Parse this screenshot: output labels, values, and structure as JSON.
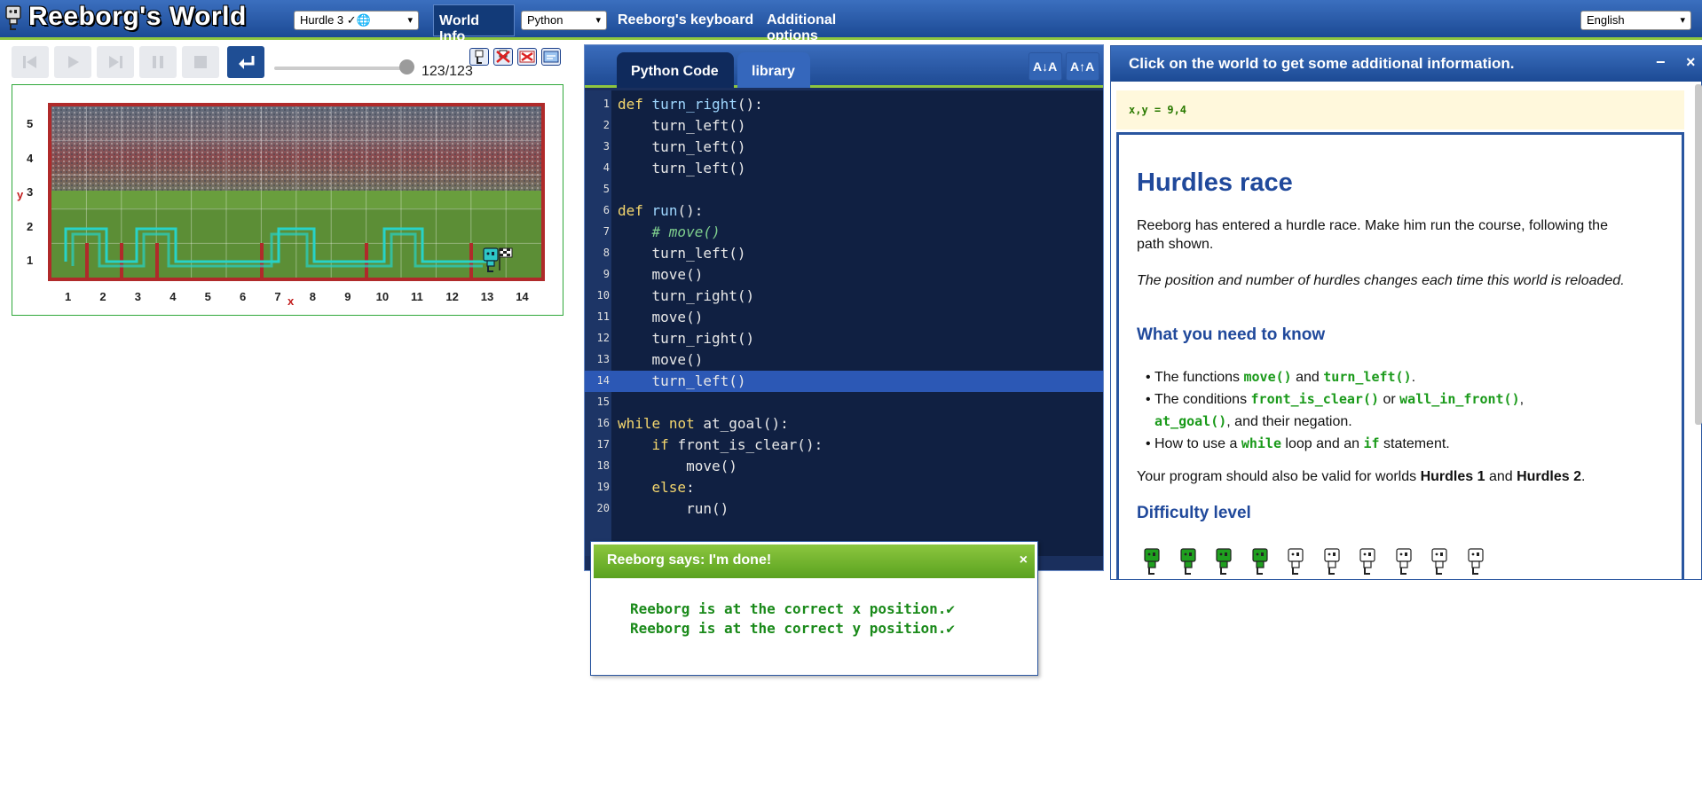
{
  "header": {
    "title": "Reeborg's World",
    "world_select": "Hurdle 3 ✓🌐",
    "world_info_label": "World Info",
    "language_select": "Python",
    "keyboard_label": "Reeborg's keyboard",
    "additional_options_label": "Additional options",
    "ui_language_select": "English"
  },
  "controls": {
    "step_counter": "123/123",
    "progress": 1.0
  },
  "world": {
    "x_axis_letter": "x",
    "y_axis_letter": "y",
    "x_ticks": [
      "1",
      "2",
      "3",
      "4",
      "5",
      "6",
      "7",
      "8",
      "9",
      "10",
      "11",
      "12",
      "13",
      "14"
    ],
    "y_ticks": [
      "5",
      "4",
      "3",
      "2",
      "1"
    ]
  },
  "editor": {
    "tabs": [
      "Python Code",
      "library"
    ],
    "font_smaller": "A↓A",
    "font_larger": "A↑A",
    "active_line": 14,
    "lines": [
      "def turn_right():",
      "    turn_left()",
      "    turn_left()",
      "    turn_left()",
      "",
      "def run():",
      "    # move()",
      "    turn_left()",
      "    move()",
      "    turn_right()",
      "    move()",
      "    turn_right()",
      "    move()",
      "    turn_left()",
      "",
      "while not at_goal():",
      "    if front_is_clear():",
      "        move()",
      "    else:",
      "        run()"
    ]
  },
  "info": {
    "header": "Click on the world to get some additional information.",
    "minimize": "−",
    "close": "×",
    "coords": "x,y = 9,4",
    "title": "Hurdles race",
    "intro": "Reeborg has entered a hurdle race. Make him run the course, following the path shown.",
    "note": "The position and number of hurdles changes each time this world is reloaded.",
    "need_heading": "What you need to know",
    "b1_pre": "The functions ",
    "b1_c1": "move()",
    "b1_mid": " and ",
    "b1_c2": "turn_left()",
    "b1_post": ".",
    "b2_pre": "The conditions ",
    "b2_c1": "front_is_clear()",
    "b2_mid": " or ",
    "b2_c2": "wall_in_front()",
    "b2_sep": ",",
    "b2_c3": "at_goal()",
    "b2_post": ", and their negation.",
    "b3_pre": "How to use a ",
    "b3_c1": "while",
    "b3_mid": " loop and an ",
    "b3_c2": "if",
    "b3_post": " statement.",
    "valid_pre": "Your program should also be valid for worlds ",
    "valid_w1": "Hurdles 1",
    "valid_mid": " and ",
    "valid_w2": "Hurdles 2",
    "valid_post": ".",
    "difficulty_heading": "Difficulty level",
    "difficulty_level": 4,
    "difficulty_max": 10
  },
  "dialog": {
    "title": "Reeborg says: I'm done!",
    "close": "×",
    "line1": "Reeborg is at the correct x position.✔",
    "line2": "Reeborg is at the correct y position.✔"
  }
}
